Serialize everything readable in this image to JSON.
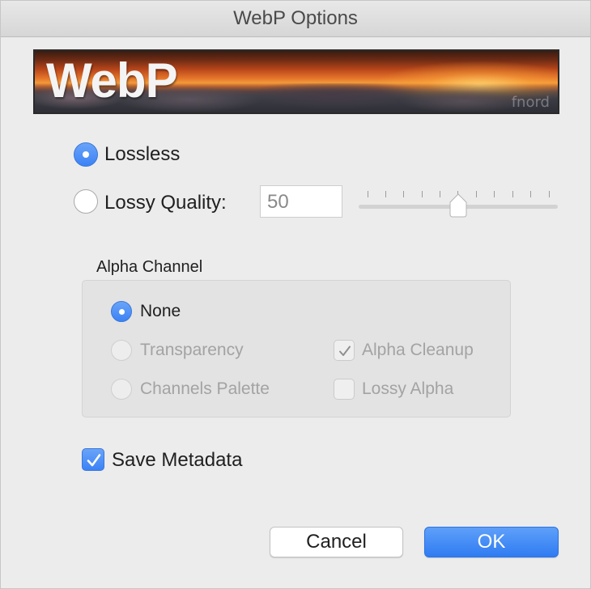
{
  "window": {
    "title": "WebP Options"
  },
  "banner": {
    "logo_text": "WebP",
    "signature_text": "fnord"
  },
  "compression": {
    "lossless_label": "Lossless",
    "lossless_selected": true,
    "lossy_label": "Lossy Quality:",
    "lossy_selected": false,
    "quality_value": "50",
    "quality_slider_fraction": 0.5
  },
  "alpha_channel": {
    "title": "Alpha Channel",
    "none_label": "None",
    "transparency_label": "Transparency",
    "channels_palette_label": "Channels Palette",
    "alpha_cleanup_label": "Alpha Cleanup",
    "alpha_cleanup_checked": true,
    "lossy_alpha_label": "Lossy Alpha",
    "lossy_alpha_checked": false
  },
  "metadata": {
    "save_label": "Save Metadata",
    "save_checked": true
  },
  "buttons": {
    "cancel_label": "Cancel",
    "ok_label": "OK"
  },
  "colors": {
    "accent": "#3b82f6",
    "window_bg": "#ececec",
    "disabled_text": "#a3a3a3"
  }
}
